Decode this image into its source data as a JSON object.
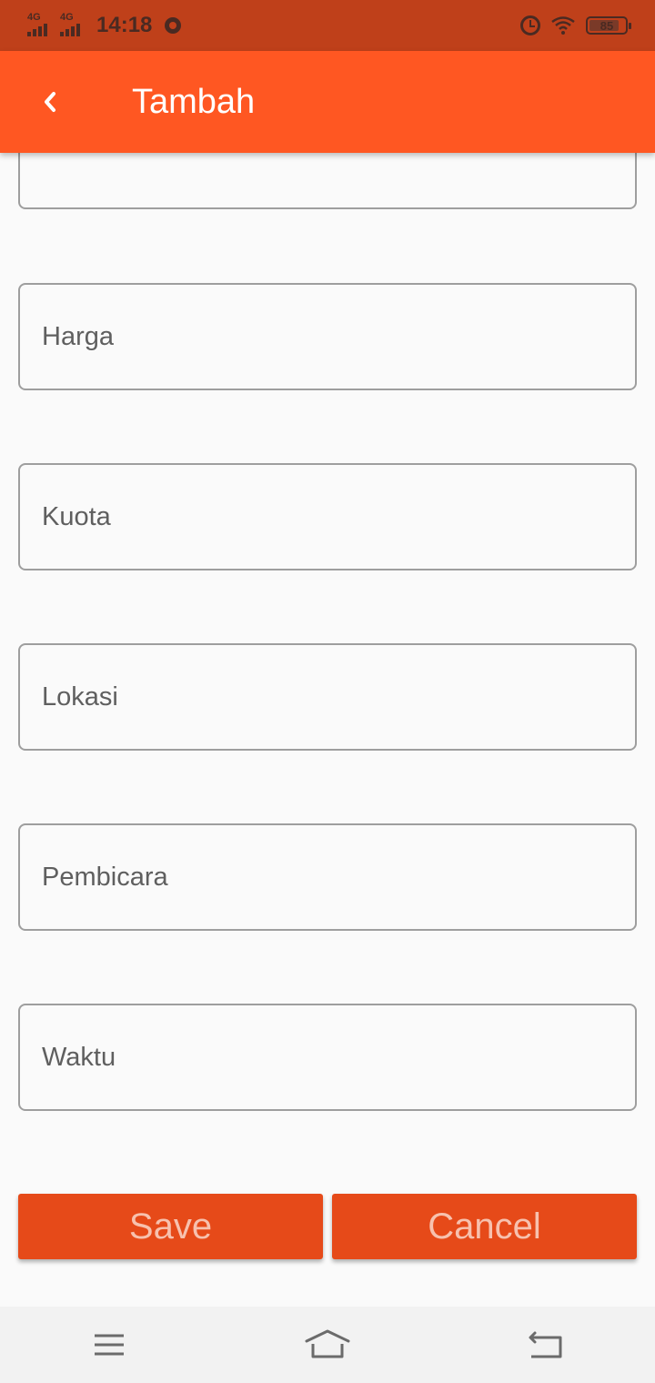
{
  "status_bar": {
    "network_1": "4G",
    "network_2": "4G",
    "time": "14:18",
    "battery_percent": 85,
    "battery_label": "85",
    "icons": [
      "signal-icon",
      "chrome-icon",
      "alarm-icon",
      "wifi-icon",
      "battery-icon"
    ]
  },
  "app_bar": {
    "title": "Tambah",
    "back_icon": "back-arrow-icon",
    "color": "#ff5722"
  },
  "form": {
    "fields": [
      {
        "placeholder": "Harga",
        "value": ""
      },
      {
        "placeholder": "Kuota",
        "value": ""
      },
      {
        "placeholder": "Lokasi",
        "value": ""
      },
      {
        "placeholder": "Pembicara",
        "value": ""
      },
      {
        "placeholder": "Waktu",
        "value": ""
      }
    ],
    "save_label": "Save",
    "cancel_label": "Cancel",
    "button_color": "#e64a19"
  },
  "nav_bar": {
    "icons": [
      "menu-icon",
      "home-icon",
      "back-icon"
    ]
  }
}
